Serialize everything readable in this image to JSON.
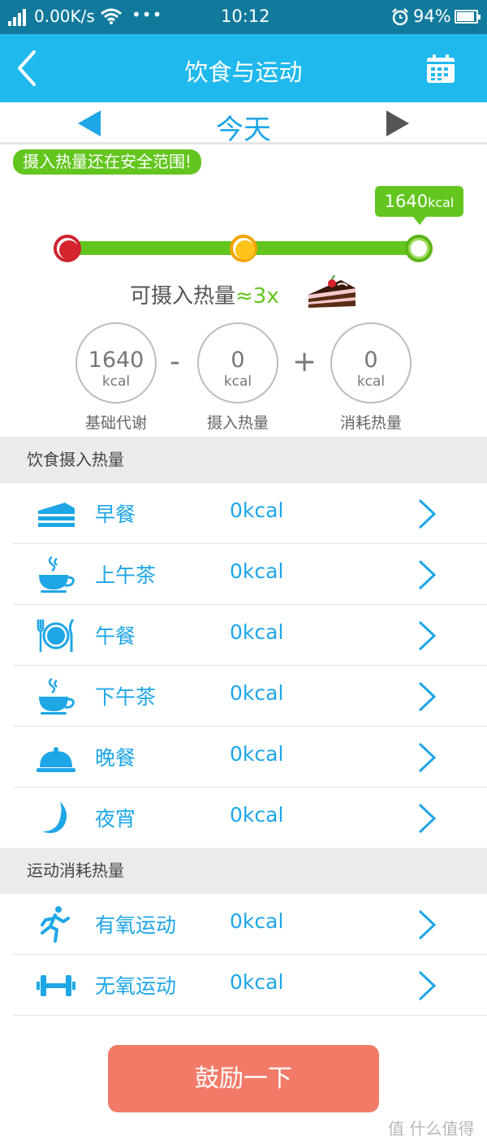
{
  "status_bar": {
    "network_speed": "0.00K/s",
    "dots": "•••",
    "time": "10:12",
    "battery": "94%"
  },
  "navbar": {
    "title": "饮食与运动",
    "back_icon": "chevron-left-icon",
    "calendar_icon": "calendar-icon"
  },
  "date_selector": {
    "label": "今天"
  },
  "safe_badge": "摄入热量还在安全范围!",
  "calorie_bubble": {
    "value": "1640",
    "unit": "kcal"
  },
  "progress": {
    "fraction": 1.0
  },
  "allowance": {
    "label": "可摄入热量",
    "multiplier": "≈3x"
  },
  "equation": {
    "basal": {
      "value": "1640",
      "unit": "kcal",
      "label": "基础代谢"
    },
    "minus": "-",
    "intake": {
      "value": "0",
      "unit": "kcal",
      "label": "摄入热量"
    },
    "plus": "+",
    "burned": {
      "value": "0",
      "unit": "kcal",
      "label": "消耗热量"
    }
  },
  "diet_section": {
    "title": "饮食摄入热量",
    "items": [
      {
        "name": "早餐",
        "value": "0kcal",
        "icon": "cake-icon"
      },
      {
        "name": "上午茶",
        "value": "0kcal",
        "icon": "tea-cup-icon"
      },
      {
        "name": "午餐",
        "value": "0kcal",
        "icon": "plate-cutlery-icon"
      },
      {
        "name": "下午茶",
        "value": "0kcal",
        "icon": "tea-cup-icon"
      },
      {
        "name": "晚餐",
        "value": "0kcal",
        "icon": "cloche-icon"
      },
      {
        "name": "夜宵",
        "value": "0kcal",
        "icon": "moon-icon"
      }
    ]
  },
  "exercise_section": {
    "title": "运动消耗热量",
    "items": [
      {
        "name": "有氧运动",
        "value": "0kcal",
        "icon": "runner-icon"
      },
      {
        "name": "无氧运动",
        "value": "0kcal",
        "icon": "dumbbell-icon"
      }
    ]
  },
  "encourage_button": "鼓励一下",
  "watermark": "值 什么值得买",
  "colors": {
    "status_bar": "#117a9c",
    "nav_bar": "#20b9ee",
    "accent_blue": "#1ea6e6",
    "green": "#62c61e",
    "button": "#f27b68"
  }
}
